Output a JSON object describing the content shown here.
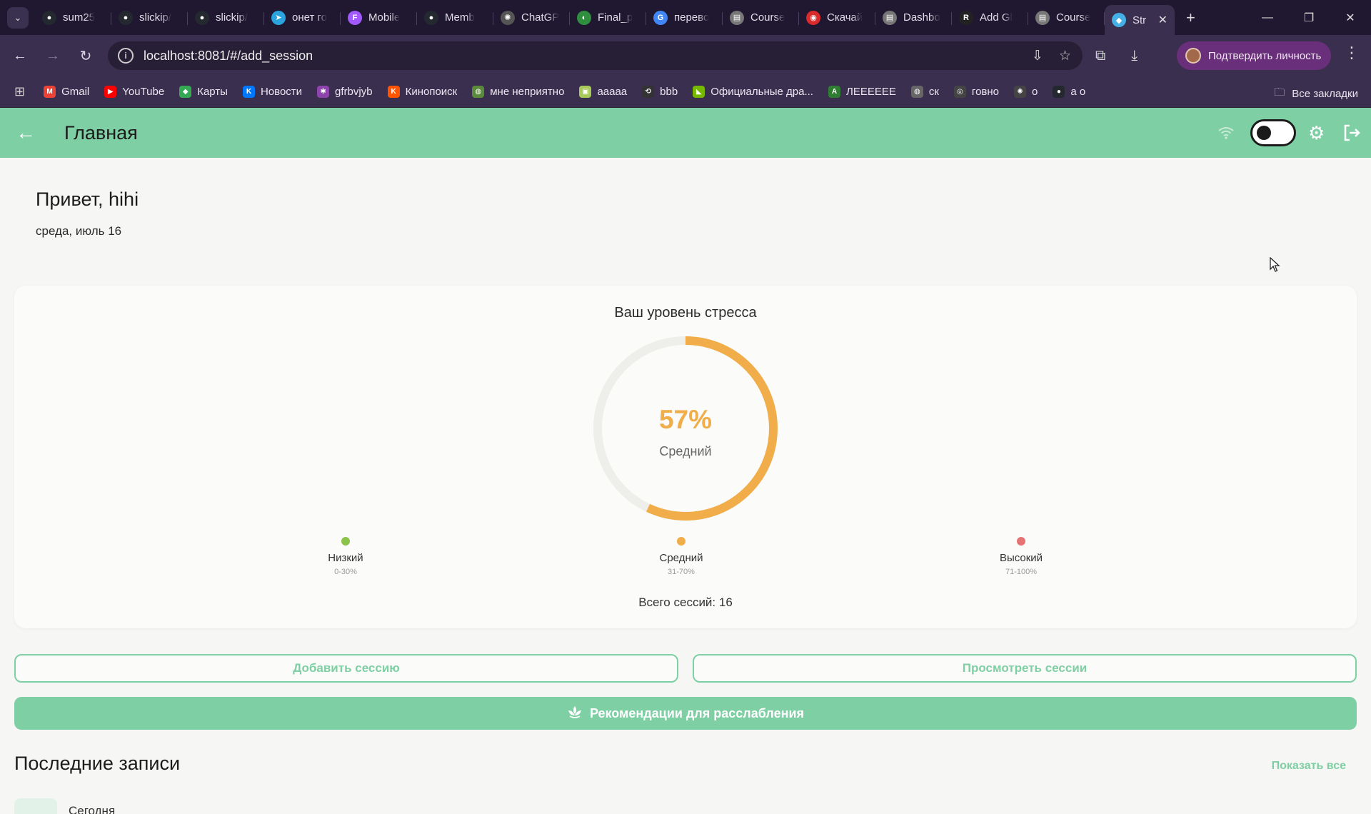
{
  "browser": {
    "tabs": [
      {
        "label": "sum25",
        "icon": "github-icon",
        "color": "#24292f"
      },
      {
        "label": "slickip/",
        "icon": "github-icon",
        "color": "#24292f"
      },
      {
        "label": "slickip/",
        "icon": "github-icon",
        "color": "#24292f"
      },
      {
        "label": "онет го",
        "icon": "telegram-icon",
        "color": "#2aa3de"
      },
      {
        "label": "Mobile",
        "icon": "figma-icon",
        "color": "#a259ff"
      },
      {
        "label": "Memb",
        "icon": "github-icon",
        "color": "#24292f"
      },
      {
        "label": "ChatGP",
        "icon": "chatgpt-icon",
        "color": "#555555"
      },
      {
        "label": "Final_p",
        "icon": "overleaf-icon",
        "color": "#2f8f3f"
      },
      {
        "label": "перево",
        "icon": "google-icon",
        "color": "#4285f4"
      },
      {
        "label": "Course",
        "icon": "page-icon",
        "color": "#777777"
      },
      {
        "label": "Скачай",
        "icon": "record-icon",
        "color": "#d92b2b"
      },
      {
        "label": "Dashbo",
        "icon": "page-icon",
        "color": "#777777"
      },
      {
        "label": "Add Gl",
        "icon": "r-icon",
        "color": "#222222"
      },
      {
        "label": "Course",
        "icon": "page-icon",
        "color": "#777777"
      }
    ],
    "active_tab": {
      "label": "Str",
      "icon": "flutter-icon",
      "color": "#45b0e6"
    },
    "url": "localhost:8081/#/add_session",
    "verify_label": "Подтвердить личность",
    "bookmarks": [
      {
        "label": "Gmail",
        "icon": "gmail-icon",
        "color": "#ea4335"
      },
      {
        "label": "YouTube",
        "icon": "youtube-icon",
        "color": "#ff0000"
      },
      {
        "label": "Карты",
        "icon": "maps-icon",
        "color": "#34a853"
      },
      {
        "label": "Новости",
        "icon": "vk-icon",
        "color": "#0077ff"
      },
      {
        "label": "gfrbvjyb",
        "icon": "puzzle-icon",
        "color": "#8e44ad"
      },
      {
        "label": "Кинопоиск",
        "icon": "kinopoisk-icon",
        "color": "#ff5500"
      },
      {
        "label": "мне неприятно",
        "icon": "globe-icon",
        "color": "#5a8a3a"
      },
      {
        "label": "ааааа",
        "icon": "image-icon",
        "color": "#a7c957"
      },
      {
        "label": "bbb",
        "icon": "link-icon",
        "color": "#333333"
      },
      {
        "label": "Официальные дра...",
        "icon": "nvidia-icon",
        "color": "#76b900"
      },
      {
        "label": "ЛЕЕЕЕЕЕ",
        "icon": "ac-icon",
        "color": "#2e7d32"
      },
      {
        "label": "ск",
        "icon": "globe-icon",
        "color": "#666666"
      },
      {
        "label": "говно",
        "icon": "chrome-icon",
        "color": "#444444"
      },
      {
        "label": "о",
        "icon": "chatgpt-icon",
        "color": "#444444"
      },
      {
        "label": "а о",
        "icon": "github-icon",
        "color": "#24292f"
      }
    ],
    "all_bookmarks": "Все закладки"
  },
  "appbar": {
    "title": "Главная"
  },
  "header": {
    "greeting": "Привет, hihi",
    "date": "среда, июль 16"
  },
  "stress": {
    "title": "Ваш уровень стресса",
    "value_text": "57%",
    "level": "Средний",
    "percent": 57,
    "legend": [
      {
        "name": "Низкий",
        "range": "0-30%",
        "color": "#8bc34a"
      },
      {
        "name": "Средний",
        "range": "31-70%",
        "color": "#f0ad4a"
      },
      {
        "name": "Высокий",
        "range": "71-100%",
        "color": "#e57373"
      }
    ],
    "total_sessions": "Всего сессий: 16",
    "accent": "#f0ad4a"
  },
  "actions": {
    "add_session": "Добавить сессию",
    "view_sessions": "Просмотреть сессии",
    "relax": "Рекомендации для расслабления"
  },
  "recent": {
    "title": "Последние записи",
    "show_all": "Показать все",
    "items": [
      {
        "date": "Сегодня"
      }
    ]
  },
  "colors": {
    "primary": "#7fcfa4",
    "browser_frame": "#3b2f4f"
  }
}
